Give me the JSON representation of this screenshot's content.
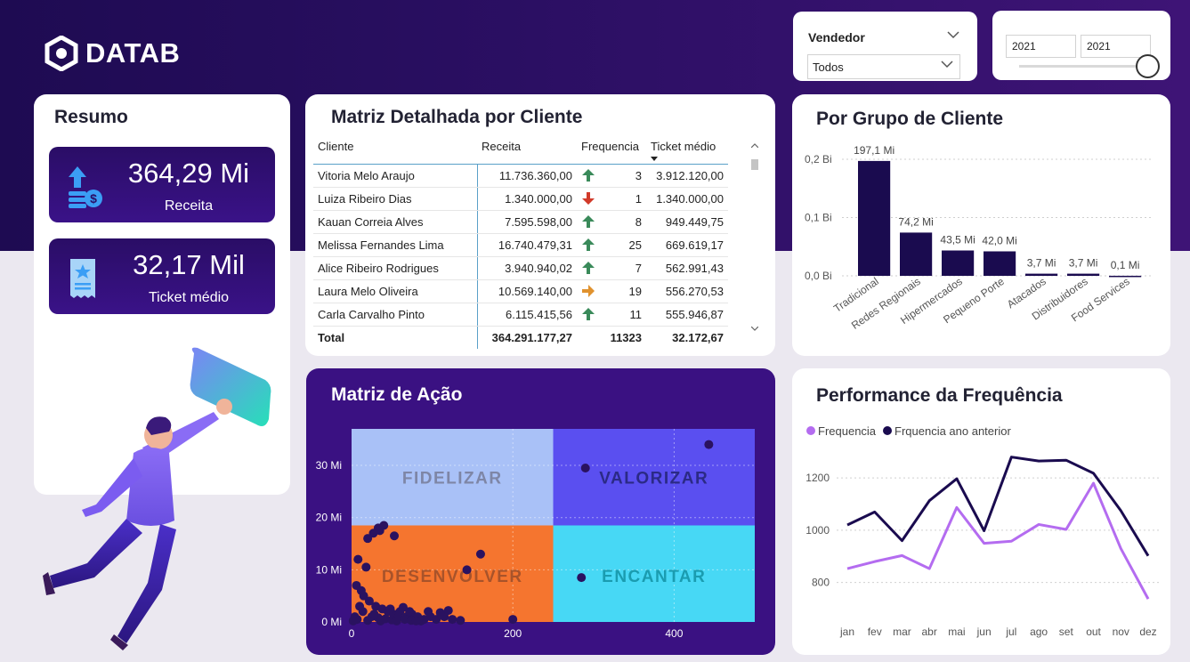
{
  "brand": {
    "name": "DATAB"
  },
  "filters": {
    "vendedor_label": "Vendedor",
    "vendedor_value": "Todos",
    "ano_start": "2021",
    "ano_end": "2021",
    "ano_slider_position": 1.0
  },
  "resumo": {
    "title": "Resumo",
    "kpis": [
      {
        "value": "364,29 Mi",
        "label": "Receita",
        "icon": "money-icon"
      },
      {
        "value": "32,17 Mil",
        "label": "Ticket médio",
        "icon": "receipt-icon"
      }
    ]
  },
  "matriz_detalhada": {
    "title": "Matriz Detalhada por Cliente",
    "columns": [
      "Cliente",
      "Receita",
      "Frequencia",
      "Ticket médio"
    ],
    "sort_column": "Ticket médio",
    "rows": [
      {
        "cliente": "Vitoria Melo Araujo",
        "receita": "11.736.360,00",
        "trend": "up",
        "frequencia": "3",
        "ticket": "3.912.120,00"
      },
      {
        "cliente": "Luiza Ribeiro Dias",
        "receita": "1.340.000,00",
        "trend": "down",
        "frequencia": "1",
        "ticket": "1.340.000,00"
      },
      {
        "cliente": "Kauan Correia Alves",
        "receita": "7.595.598,00",
        "trend": "up",
        "frequencia": "8",
        "ticket": "949.449,75"
      },
      {
        "cliente": "Melissa Fernandes Lima",
        "receita": "16.740.479,31",
        "trend": "up",
        "frequencia": "25",
        "ticket": "669.619,17"
      },
      {
        "cliente": "Alice Ribeiro Rodrigues",
        "receita": "3.940.940,02",
        "trend": "up",
        "frequencia": "7",
        "ticket": "562.991,43"
      },
      {
        "cliente": "Laura Melo Oliveira",
        "receita": "10.569.140,00",
        "trend": "right",
        "frequencia": "19",
        "ticket": "556.270,53"
      },
      {
        "cliente": "Carla Carvalho Pinto",
        "receita": "6.115.415,56",
        "trend": "up",
        "frequencia": "11",
        "ticket": "555.946,87"
      }
    ],
    "total": {
      "label": "Total",
      "receita": "364.291.177,27",
      "frequencia": "11323",
      "ticket": "32.172,67"
    }
  },
  "colors": {
    "bar": "#1a0b4f",
    "line_current": "#b46cf0",
    "line_previous": "#1a0b4f",
    "arrow_up": "#3a8a5a",
    "arrow_down": "#d13a2a",
    "arrow_right": "#e0922e",
    "q_fidelizar": "#a9c1f7",
    "q_valorizar": "#5a4ff0",
    "q_desenvolver": "#f5752f",
    "q_encantar": "#47d8f5"
  },
  "chart_data": [
    {
      "type": "bar",
      "title": "Por Grupo de Cliente",
      "categories": [
        "Tradicional",
        "Redes Regionais",
        "Hipermercados",
        "Pequeno Porte",
        "Atacados",
        "Distribuidores",
        "Food Services"
      ],
      "values": [
        197.1,
        74.2,
        43.5,
        42.0,
        3.7,
        3.7,
        0.1
      ],
      "unit": "Mi",
      "data_labels": [
        "197,1 Mi",
        "74,2 Mi",
        "43,5 Mi",
        "42,0 Mi",
        "3,7 Mi",
        "3,7 Mi",
        "0,1 Mi"
      ],
      "yticks": [
        "0,0 Bi",
        "0,1 Bi",
        "0,2 Bi"
      ],
      "ylim": [
        0,
        200
      ],
      "grid": true
    },
    {
      "type": "scatter",
      "title": "Matriz de Ação",
      "xlim": [
        0,
        500
      ],
      "ylim": [
        0,
        37
      ],
      "xticks": [
        "0",
        "200",
        "400"
      ],
      "yticks": [
        "0 Mi",
        "10 Mi",
        "20 Mi",
        "30 Mi"
      ],
      "quadrants": [
        "FIDELIZAR",
        "VALORIZAR",
        "DESENVOLVER",
        "ENCANTAR"
      ],
      "x_split": 250,
      "y_split": 18.5,
      "points": [
        [
          443,
          34
        ],
        [
          290,
          29.5
        ],
        [
          285,
          8.5
        ],
        [
          160,
          13
        ],
        [
          143,
          10
        ],
        [
          200,
          0.5
        ],
        [
          33,
          18
        ],
        [
          40,
          18.5
        ],
        [
          27,
          17
        ],
        [
          35,
          17.5
        ],
        [
          20,
          16
        ],
        [
          53,
          16.5
        ],
        [
          8,
          12
        ],
        [
          18,
          10.5
        ],
        [
          6,
          7
        ],
        [
          12,
          6
        ],
        [
          15,
          5
        ],
        [
          22,
          4
        ],
        [
          30,
          3
        ],
        [
          38,
          2.5
        ],
        [
          45,
          2
        ],
        [
          52,
          1.5
        ],
        [
          60,
          2
        ],
        [
          68,
          1
        ],
        [
          75,
          1.5
        ],
        [
          82,
          1
        ],
        [
          90,
          0.5
        ],
        [
          98,
          1
        ],
        [
          105,
          0.5
        ],
        [
          115,
          1
        ],
        [
          125,
          0.5
        ],
        [
          135,
          0.3
        ],
        [
          10,
          3
        ],
        [
          14,
          2
        ],
        [
          4,
          1
        ],
        [
          7,
          0.5
        ],
        [
          25,
          1
        ],
        [
          33,
          0.8
        ],
        [
          42,
          0.6
        ],
        [
          50,
          0.4
        ],
        [
          58,
          0.9
        ],
        [
          66,
          0.5
        ],
        [
          74,
          0.3
        ],
        [
          86,
          0.2
        ],
        [
          20,
          0.3
        ],
        [
          28,
          1.5
        ],
        [
          36,
          0.2
        ],
        [
          48,
          2.5
        ],
        [
          56,
          0.2
        ],
        [
          64,
          2.8
        ],
        [
          72,
          2
        ],
        [
          80,
          0.2
        ],
        [
          95,
          2
        ],
        [
          110,
          1.8
        ],
        [
          120,
          2.2
        ],
        [
          2,
          0.2
        ]
      ]
    },
    {
      "type": "line",
      "title": "Performance da Frequência",
      "x": [
        "jan",
        "fev",
        "mar",
        "abr",
        "mai",
        "jun",
        "jul",
        "ago",
        "set",
        "out",
        "nov",
        "dez"
      ],
      "series": [
        {
          "name": "Frequencia",
          "values": [
            853,
            880,
            903,
            853,
            1087,
            950,
            958,
            1022,
            1003,
            1180,
            930,
            737
          ]
        },
        {
          "name": "Frquencia ano anterior",
          "values": [
            1020,
            1070,
            960,
            1113,
            1197,
            998,
            1280,
            1265,
            1268,
            1218,
            1075,
            902
          ]
        }
      ],
      "yticks": [
        "800",
        "1000",
        "1200"
      ],
      "ylim": [
        700,
        1330
      ],
      "grid": true
    }
  ]
}
